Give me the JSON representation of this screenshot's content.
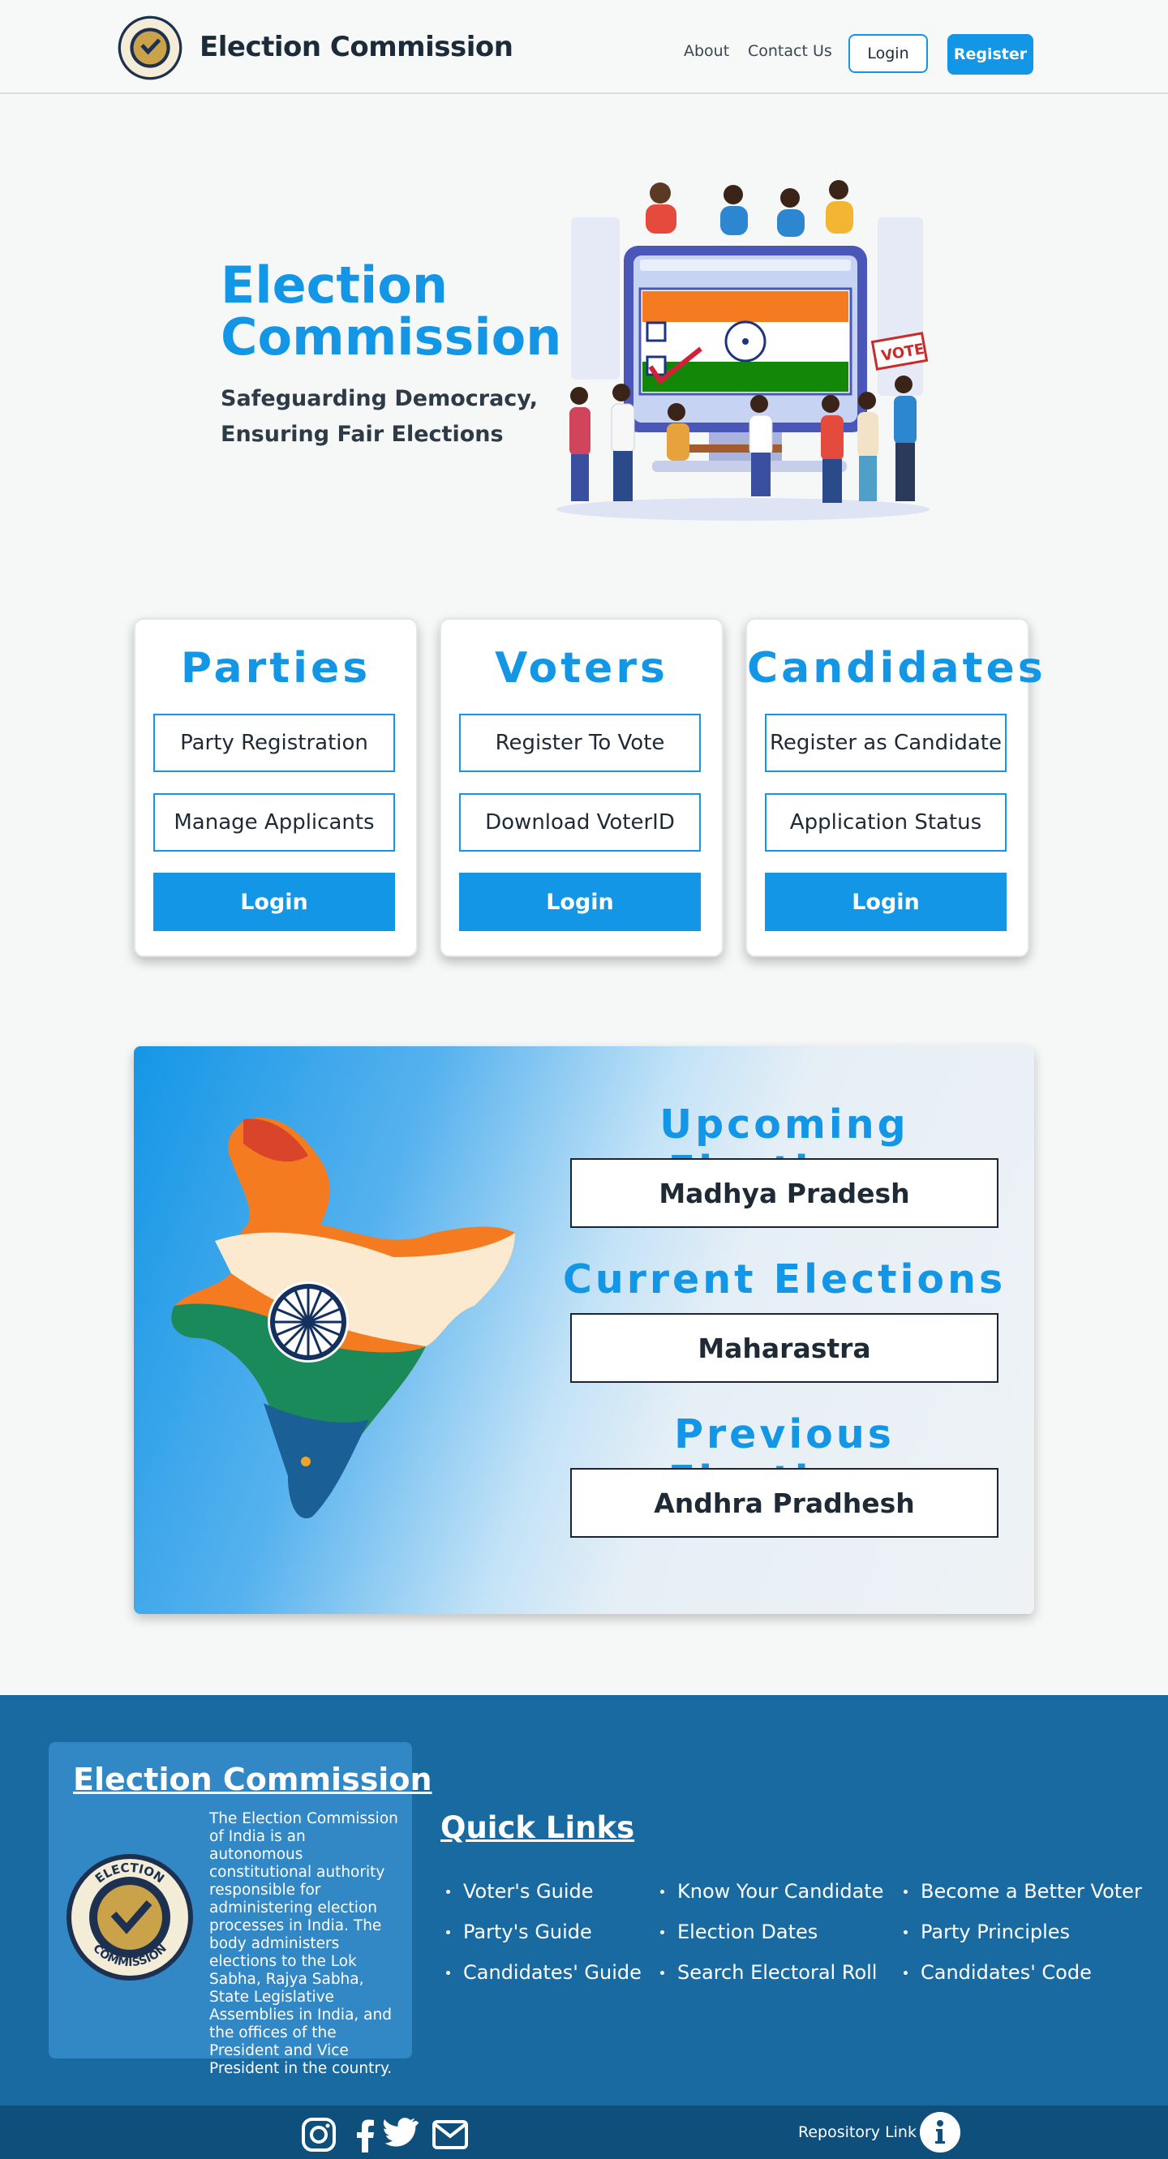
{
  "nav": {
    "title": "Election Commission",
    "about": "About",
    "contact": "Contact Us",
    "login": "Login",
    "register": "Register"
  },
  "hero": {
    "title_line1": "Election",
    "title_line2": "Commission",
    "subtitle_line1": "Safeguarding Democracy,",
    "subtitle_line2": "Ensuring Fair Elections",
    "illustration_sign": "VOTE"
  },
  "cards": [
    {
      "title": "Parties",
      "button1": "Party Registration",
      "button2": "Manage Applicants",
      "login": "Login"
    },
    {
      "title": "Voters",
      "button1": "Register To Vote",
      "button2": "Download VoterID",
      "login": "Login"
    },
    {
      "title": "Candidates",
      "button1": "Register as Candidate",
      "button2": "Application Status",
      "login": "Login"
    }
  ],
  "elections": {
    "upcoming_heading": "Upcoming Elections",
    "upcoming_state": "Madhya Pradesh",
    "current_heading": "Current Elections",
    "current_state": "Maharastra",
    "previous_heading": "Previous Elections",
    "previous_state": "Andhra Pradhesh"
  },
  "footer": {
    "about_title": "Election Commission",
    "about_text": "The Election Commission of India is an autonomous constitutional authority responsible for administering election processes in India. The body administers elections to the Lok Sabha, Rajya Sabha, State Legislative Assemblies in India, and the offices of the President and Vice President in the country.",
    "logo_text_top": "ELECTION",
    "logo_text_bottom": "COMMISSION",
    "quick_links_title": "Quick Links",
    "links_col1": [
      "Voter's Guide",
      "Party's Guide",
      "Candidates' Guide"
    ],
    "links_col2": [
      "Know Your Candidate",
      "Election Dates",
      "Search Electoral Roll"
    ],
    "links_col3": [
      "Become a Better Voter",
      "Party Principles",
      "Candidates' Code"
    ],
    "repository_link": "Repository Link",
    "social_icons": [
      "instagram-icon",
      "facebook-icon",
      "twitter-icon",
      "mail-icon"
    ]
  },
  "colors": {
    "primary": "#1496e6",
    "footer": "#1a6aa2",
    "footer_bottom": "#0f4f7c",
    "saffron": "#f47b20",
    "green": "#138808"
  }
}
